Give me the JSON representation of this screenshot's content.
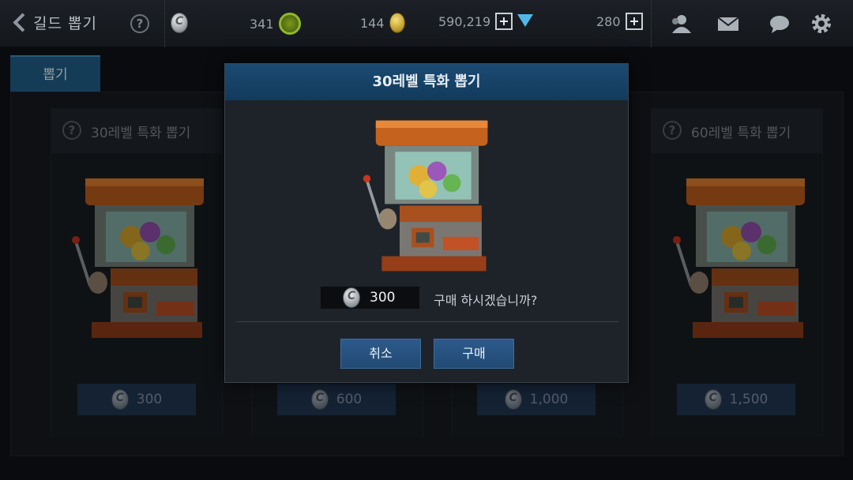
{
  "topbar": {
    "title": "길드 뽑기",
    "help_icon": "?",
    "currencies": [
      {
        "name": "leaf-medal",
        "value": "341"
      },
      {
        "name": "gold-coin",
        "value": "144"
      },
      {
        "name": "gem",
        "value": "590,219"
      },
      {
        "name": "energy",
        "value": "280"
      }
    ]
  },
  "tab": {
    "label": "뽑기"
  },
  "cards": [
    {
      "title": "30레벨 특화 뽑기",
      "price": "300"
    },
    {
      "title": "",
      "price": "600"
    },
    {
      "title": "",
      "price": "1,000"
    },
    {
      "title": "60레벨 특화 뽑기",
      "price": "1,500"
    }
  ],
  "modal": {
    "title": "30레벨 특화 뽑기",
    "price": "300",
    "question": "구매 하시겠습니까?",
    "cancel_label": "취소",
    "buy_label": "구매"
  },
  "colors": {
    "accent": "#1f5d86",
    "modal_header": "#1b4a72",
    "button": "#2c5a8a"
  }
}
